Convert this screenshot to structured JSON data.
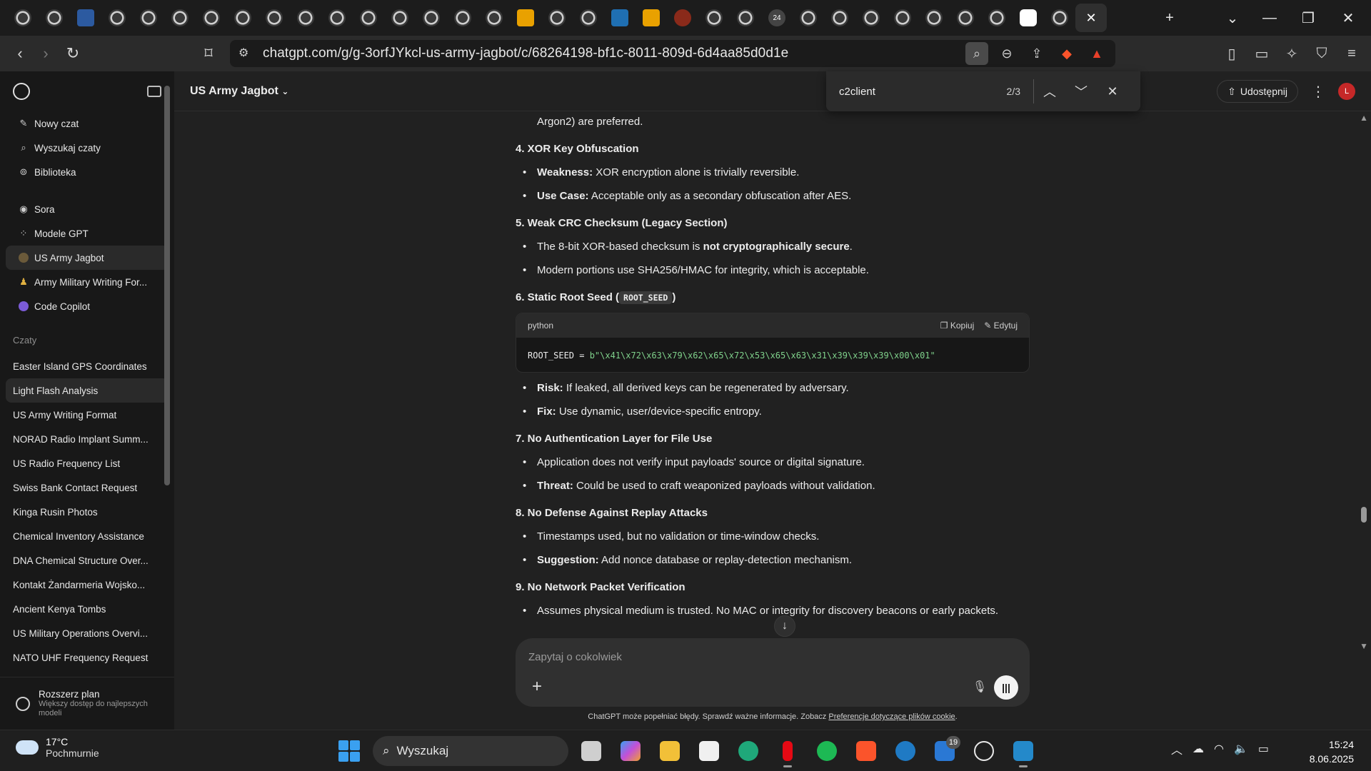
{
  "browser": {
    "url": "chatgpt.com/g/g-3orfJYkcl-us-army-jagbot/c/68264198-bf1c-8011-809d-6d4aa85d0d1e",
    "tab_badge_count": "24"
  },
  "find": {
    "query": "c2client",
    "count": "2/3"
  },
  "sidebar": {
    "top_items": [
      {
        "label": "Nowy czat",
        "icon": "edit-icon"
      },
      {
        "label": "Wyszukaj czaty",
        "icon": "search-icon"
      },
      {
        "label": "Biblioteka",
        "icon": "library-icon"
      }
    ],
    "gpt_items": [
      {
        "label": "Sora",
        "icon": "sora-icon"
      },
      {
        "label": "Modele GPT",
        "icon": "grid-icon"
      },
      {
        "label": "US Army Jagbot",
        "icon": "jagbot-icon"
      },
      {
        "label": "Army Military Writing For...",
        "icon": "army-icon"
      },
      {
        "label": "Code Copilot",
        "icon": "copilot-icon"
      }
    ],
    "section_label": "Czaty",
    "chats": [
      "Easter Island GPS Coordinates",
      "Light Flash Analysis",
      "US Army Writing Format",
      "NORAD Radio Implant Summ...",
      "US Radio Frequency List",
      "Swiss Bank Contact Request",
      "Kinga Rusin Photos",
      "Chemical Inventory Assistance",
      "DNA Chemical Structure Over...",
      "Kontakt Żandarmeria Wojsko...",
      "Ancient Kenya Tombs",
      "US Military Operations Overvi...",
      "NATO UHF Frequency Request"
    ],
    "upgrade_title": "Rozszerz plan",
    "upgrade_sub": "Większy dostęp do najlepszych modeli"
  },
  "header": {
    "model": "US Army Jagbot",
    "share_label": "Udostępnij",
    "avatar": "L"
  },
  "content": {
    "intro_tail": "Argon2) are preferred.",
    "s4_title": "4. XOR Key Obfuscation",
    "s4_b1_k": "Weakness:",
    "s4_b1_v": " XOR encryption alone is trivially reversible.",
    "s4_b2_k": "Use Case:",
    "s4_b2_v": " Acceptable only as a secondary obfuscation after AES.",
    "s5_title": "5. Weak CRC Checksum (Legacy Section)",
    "s5_b1_a": "The 8-bit XOR-based checksum is ",
    "s5_b1_b": "not cryptographically secure",
    "s5_b1_c": ".",
    "s5_b2": "Modern portions use SHA256/HMAC for integrity, which is acceptable.",
    "s6_title": "6. Static Root Seed (",
    "s6_code": "ROOT_SEED",
    "s6_close": ")",
    "code_lang": "python",
    "code_copy": "Kopiuj",
    "code_edit": "Edytuj",
    "code_var": "ROOT_SEED = ",
    "code_val": "b\"\\x41\\x72\\x63\\x79\\x62\\x65\\x72\\x53\\x65\\x63\\x31\\x39\\x39\\x39\\x00\\x01\"",
    "s6_b1_k": "Risk:",
    "s6_b1_v": " If leaked, all derived keys can be regenerated by adversary.",
    "s6_b2_k": "Fix:",
    "s6_b2_v": " Use dynamic, user/device-specific entropy.",
    "s7_title": "7. No Authentication Layer for File Use",
    "s7_b1": "Application does not verify input payloads' source or digital signature.",
    "s7_b2_k": "Threat:",
    "s7_b2_v": " Could be used to craft weaponized payloads without validation.",
    "s8_title": "8. No Defense Against Replay Attacks",
    "s8_b1": "Timestamps used, but no validation or time-window checks.",
    "s8_b2_k": "Suggestion:",
    "s8_b2_v": " Add nonce database or replay-detection mechanism.",
    "s9_title": "9. No Network Packet Verification",
    "s9_b1": "Assumes physical medium is trusted. No MAC or integrity for discovery beacons or early packets."
  },
  "composer": {
    "placeholder": "Zapytaj o cokolwiek"
  },
  "disclaimer": {
    "text": "ChatGPT może popełniać błędy. Sprawdź ważne informacje. Zobacz ",
    "link": "Preferencje dotyczące plików cookie",
    "end": "."
  },
  "taskbar": {
    "temp": "17°C",
    "weather": "Pochmurnie",
    "search": "Wyszukaj",
    "mail_badge": "19",
    "time": "15:24",
    "date": "8.06.2025"
  }
}
